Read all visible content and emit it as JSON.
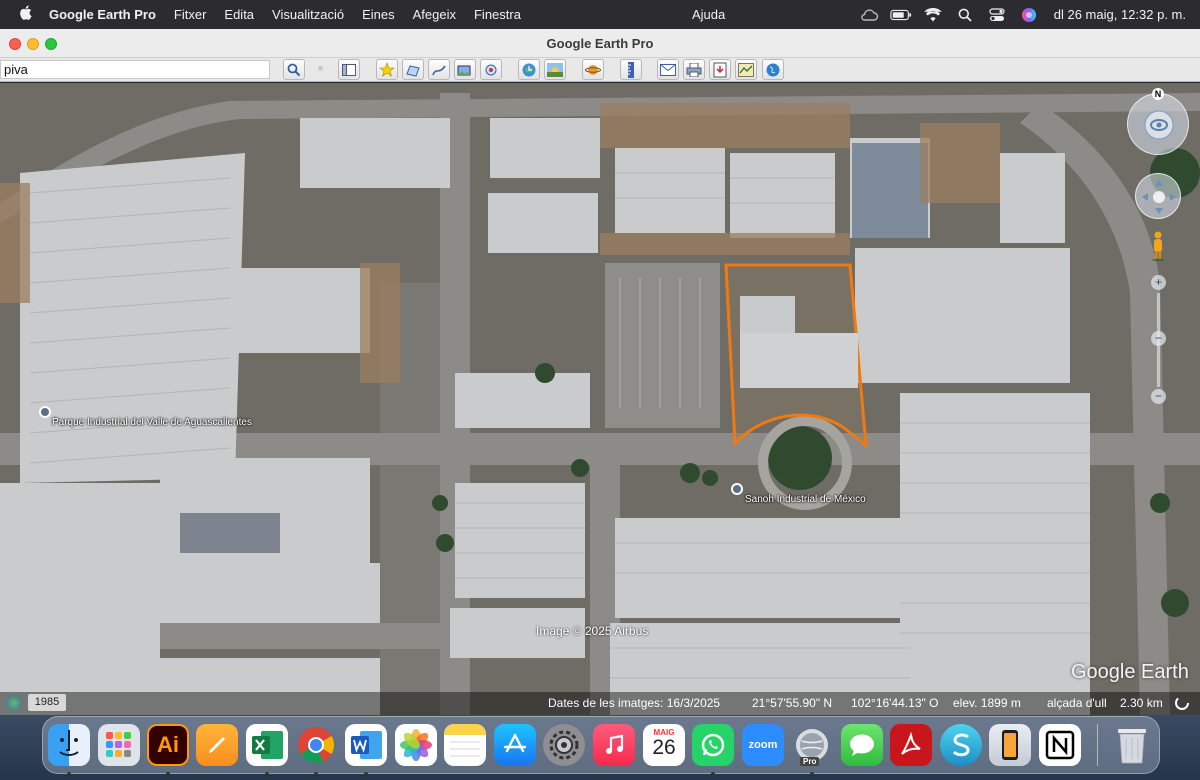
{
  "menubar": {
    "app_name": "Google Earth Pro",
    "items": [
      "Fitxer",
      "Edita",
      "Visualització",
      "Eines",
      "Afegeix",
      "Finestra"
    ],
    "help": "Ajuda",
    "clock": "dl 26 maig, 12:32 p. m."
  },
  "window": {
    "title": "Google Earth Pro"
  },
  "search": {
    "value": "piva"
  },
  "map": {
    "labels": {
      "park": "Parque Industrial del Valle de Aguascalientes",
      "company": "Sanoh Industrial de México"
    },
    "imagery_credit": "Image © 2025 Airbus",
    "logo": "Google Earth",
    "compass_letter": "N",
    "zoom_plus": "+",
    "zoom_minus": "−",
    "highlight_color": "#f07a10"
  },
  "statusbar": {
    "year": "1985",
    "imagery_date": "Dates de les imatges: 16/3/2025",
    "lat": "21°57'55.90\" N",
    "lon": "102°16'44.13\" O",
    "elev": "elev. 1899 m",
    "eye_alt": "alçada d'ull",
    "eye_alt_value": "2.30 km"
  },
  "dock": {
    "calendar_month": "MAIG",
    "calendar_day": "26",
    "illustrator_label": "Ai",
    "zoom_label": "zoom",
    "ge_pro_label": "Pro",
    "apps": [
      "finder",
      "launchpad",
      "illustrator",
      "pages",
      "excel",
      "chrome",
      "word",
      "photos",
      "notes",
      "app-store",
      "system-settings",
      "music",
      "calendar",
      "whatsapp",
      "zoom",
      "google-earth-pro",
      "messages",
      "acrobat",
      "s-app",
      "iphone-mirroring",
      "notion",
      "trash"
    ]
  }
}
